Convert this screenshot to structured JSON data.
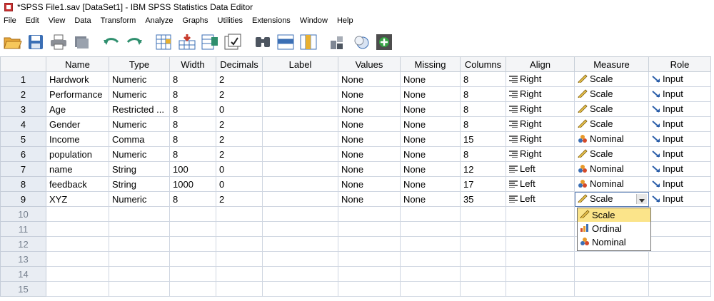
{
  "window": {
    "title": "*SPSS File1.sav [DataSet1] - IBM SPSS Statistics Data Editor"
  },
  "menu": [
    "File",
    "Edit",
    "View",
    "Data",
    "Transform",
    "Analyze",
    "Graphs",
    "Utilities",
    "Extensions",
    "Window",
    "Help"
  ],
  "toolbar": [
    "open-icon",
    "save-icon",
    "print-icon",
    "dialog-recall-icon",
    "undo-icon",
    "redo-icon",
    "goto-case-icon",
    "goto-variable-icon",
    "variables-icon",
    "run-descriptives-icon",
    "find-icon",
    "insert-cases-icon",
    "insert-variable-icon",
    "split-file-icon",
    "weight-cases-icon",
    "select-cases-icon",
    "value-labels-icon",
    "use-sets-icon"
  ],
  "columns": [
    "Name",
    "Type",
    "Width",
    "Decimals",
    "Label",
    "Values",
    "Missing",
    "Columns",
    "Align",
    "Measure",
    "Role"
  ],
  "rows": [
    {
      "num": "1",
      "name": "Hardwork",
      "type": "Numeric",
      "width": "8",
      "decimals": "2",
      "label": "",
      "values": "None",
      "missing": "None",
      "columns": "8",
      "align": "Right",
      "measure": "Scale",
      "role": "Input"
    },
    {
      "num": "2",
      "name": "Performance",
      "type": "Numeric",
      "width": "8",
      "decimals": "2",
      "label": "",
      "values": "None",
      "missing": "None",
      "columns": "8",
      "align": "Right",
      "measure": "Scale",
      "role": "Input"
    },
    {
      "num": "3",
      "name": "Age",
      "type": "Restricted ...",
      "width": "8",
      "decimals": "0",
      "label": "",
      "values": "None",
      "missing": "None",
      "columns": "8",
      "align": "Right",
      "measure": "Scale",
      "role": "Input"
    },
    {
      "num": "4",
      "name": "Gender",
      "type": "Numeric",
      "width": "8",
      "decimals": "2",
      "label": "",
      "values": "None",
      "missing": "None",
      "columns": "8",
      "align": "Right",
      "measure": "Scale",
      "role": "Input"
    },
    {
      "num": "5",
      "name": "Income",
      "type": "Comma",
      "width": "8",
      "decimals": "2",
      "label": "",
      "values": "None",
      "missing": "None",
      "columns": "15",
      "align": "Right",
      "measure": "Nominal",
      "role": "Input"
    },
    {
      "num": "6",
      "name": "population",
      "type": "Numeric",
      "width": "8",
      "decimals": "2",
      "label": "",
      "values": "None",
      "missing": "None",
      "columns": "8",
      "align": "Right",
      "measure": "Scale",
      "role": "Input"
    },
    {
      "num": "7",
      "name": "name",
      "type": "String",
      "width": "100",
      "decimals": "0",
      "label": "",
      "values": "None",
      "missing": "None",
      "columns": "12",
      "align": "Left",
      "measure": "Nominal",
      "role": "Input"
    },
    {
      "num": "8",
      "name": "feedback",
      "type": "String",
      "width": "1000",
      "decimals": "0",
      "label": "",
      "values": "None",
      "missing": "None",
      "columns": "17",
      "align": "Left",
      "measure": "Nominal",
      "role": "Input"
    },
    {
      "num": "9",
      "name": "XYZ",
      "type": "Numeric",
      "width": "8",
      "decimals": "2",
      "label": "",
      "values": "None",
      "missing": "None",
      "columns": "35",
      "align": "Left",
      "measure": "Scale",
      "role": "Input"
    }
  ],
  "empty_rows": [
    "10",
    "11",
    "12",
    "13",
    "14",
    "15"
  ],
  "measure_dropdown": {
    "options": [
      "Scale",
      "Ordinal",
      "Nominal"
    ],
    "selected": "Scale"
  }
}
